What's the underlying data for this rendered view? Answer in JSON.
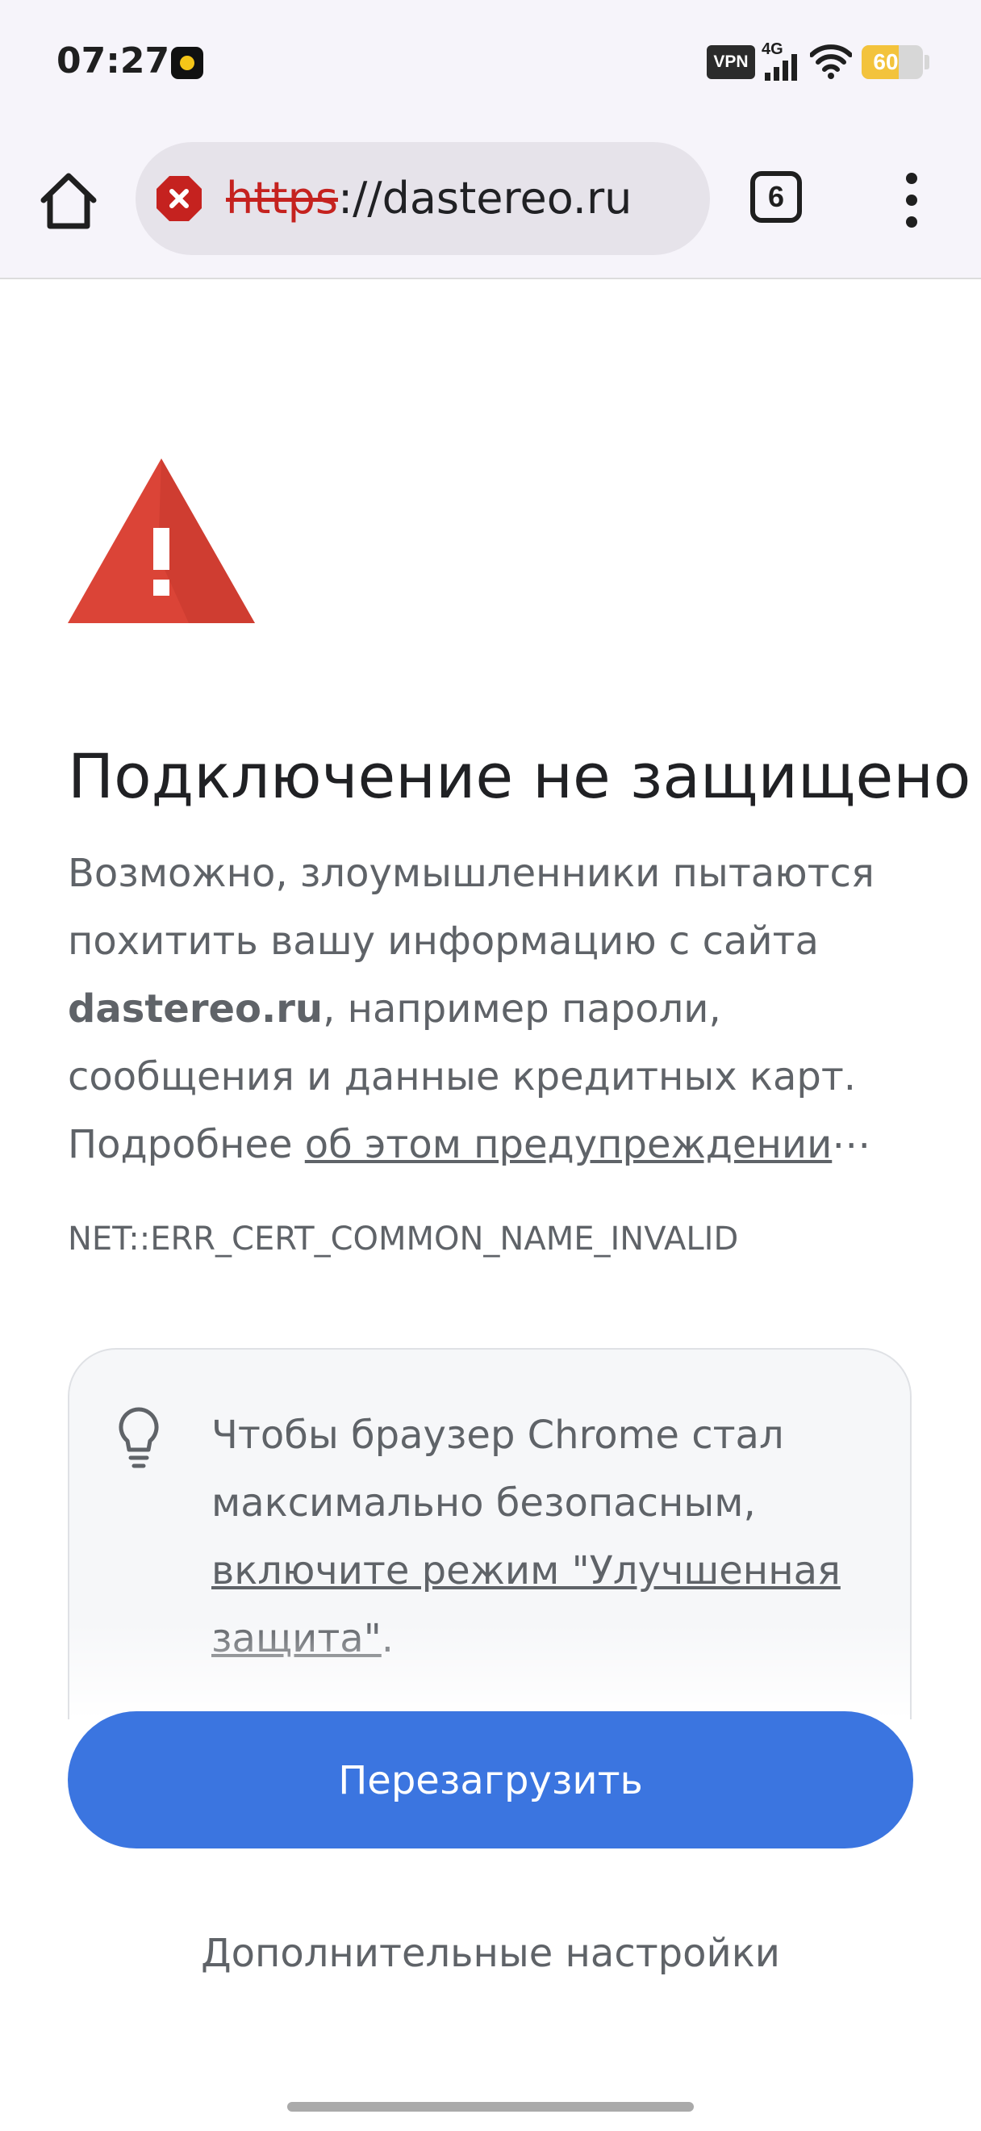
{
  "status_bar": {
    "time": "07:27",
    "vpn_label": "VPN",
    "network_type": "4G",
    "battery_level": "60",
    "battery_fraction": 0.6,
    "icons": [
      "notification-app-icon",
      "signal-icon",
      "wifi-icon",
      "battery-icon"
    ]
  },
  "toolbar": {
    "url_scheme": "https",
    "url_rest": "://dastereo.ru",
    "tab_count": "6",
    "security_status": "not-secure",
    "security_color": "#c5221f"
  },
  "page": {
    "heading": "Подключение не защищено",
    "body_part1": "Возможно, злоумышленники пытаются похитить вашу информацию с сайта ",
    "body_domain": "dastereo.ru",
    "body_part2": ", например пароли, сообщения и данные кредитных карт. Подробнее ",
    "body_link": "об этом предупреждении",
    "body_ellipsis": "⋯",
    "error_code": "NET::ERR_CERT_COMMON_NAME_INVALID",
    "warning_color": "#db4437"
  },
  "tip": {
    "text": "Чтобы браузер Chrome стал максимально безопасным, ",
    "link": "включите режим \"Улучшенная защита\"",
    "suffix": "."
  },
  "actions": {
    "reload_label": "Перезагрузить",
    "advanced_label": "Дополнительные настройки",
    "accent_color": "#3b75e0"
  }
}
